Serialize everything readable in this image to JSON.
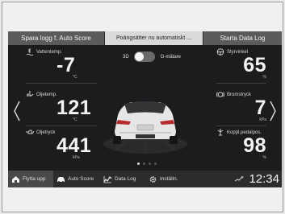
{
  "topbar": {
    "left_label": "Spara logg f. Auto Score",
    "middle_text": "Poängsätter nu automatiskt ...",
    "right_label": "Starta Data Log"
  },
  "gauges": {
    "water_temp": {
      "label": "Vattentemp.",
      "value": "-7",
      "unit": "°C"
    },
    "oil_temp": {
      "label": "Oljetemp.",
      "value": "121",
      "unit": "°C"
    },
    "oil_pressure": {
      "label": "Oljetryck",
      "value": "441",
      "unit": "kPa"
    },
    "steering_angle": {
      "label": "Styrvinkel",
      "value": "65",
      "unit": "%"
    },
    "brake_pressure": {
      "label": "Bromstryck",
      "value": "7",
      "unit": "kPa"
    },
    "clutch_pedal": {
      "label": "Koppl.pedalpos.",
      "value": "98",
      "unit": "%"
    }
  },
  "view_toggle": {
    "left_label": "3D",
    "right_label": "G-mätare"
  },
  "pagination": {
    "pages": 4,
    "current": 1
  },
  "bottom_nav": {
    "items": [
      {
        "label": "Flytta upp",
        "icon": "home-icon"
      },
      {
        "label": "Auto Score",
        "icon": "car-icon"
      },
      {
        "label": "Data Log",
        "icon": "data-log-icon"
      },
      {
        "label": "Inställn.",
        "icon": "gear-icon"
      }
    ],
    "clock": "12:34",
    "signal_icon": "signal-icon"
  }
}
